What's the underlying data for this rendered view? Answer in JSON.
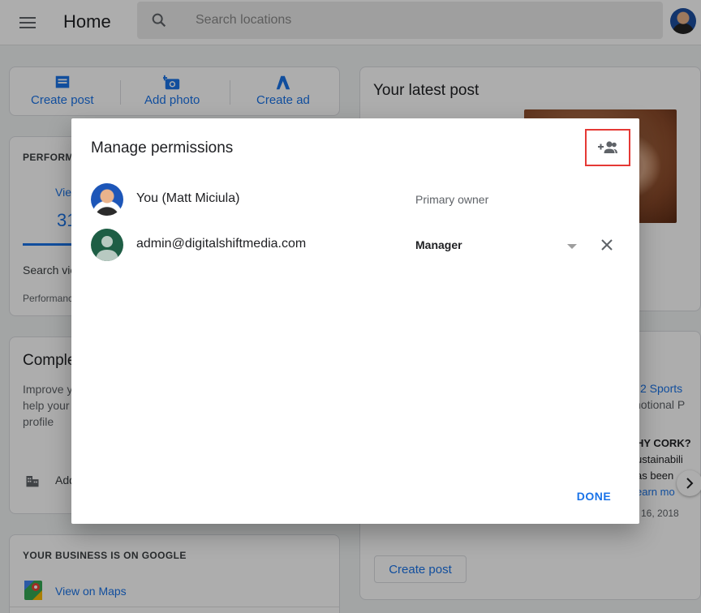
{
  "header": {
    "title": "Home",
    "search_placeholder": "Search locations"
  },
  "actions": {
    "create_post": "Create post",
    "add_photo": "Add photo",
    "create_ad": "Create ad"
  },
  "performance": {
    "title": "PERFORM",
    "tab_label": "Vie",
    "value": "31",
    "search_label": "Search vie",
    "footer": "Performanc"
  },
  "complete_profile": {
    "title": "Comple",
    "body_lines": [
      "Improve y",
      "help your",
      "profile"
    ],
    "add_label": "Add"
  },
  "business": {
    "title": "YOUR BUSINESS IS ON GOOGLE",
    "maps_link": "View on Maps"
  },
  "latest_post": {
    "title": "Your latest post"
  },
  "posts_partial": {
    "link": "l 2 Sports",
    "gray": "notional P",
    "bold": "HY CORK?",
    "line1": "ustainabili",
    "line2": "as been",
    "learn": "earn mo",
    "date": "l 16, 2018",
    "create_post_button": "Create post"
  },
  "dialog": {
    "title": "Manage permissions",
    "rows": [
      {
        "name": "You (Matt Miciula)",
        "role": "Primary owner"
      },
      {
        "name": "admin@digitalshiftmedia.com",
        "role": "Manager"
      }
    ],
    "done_label": "DONE"
  },
  "colors": {
    "accent": "#1a73e8",
    "highlight_border": "#e53935",
    "scrim": "rgba(0,0,0,0.32)"
  }
}
